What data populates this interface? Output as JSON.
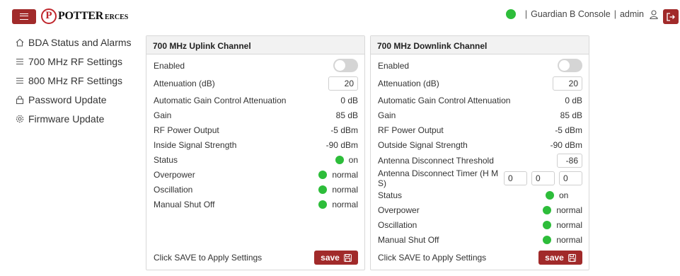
{
  "header": {
    "logo_mark": "P",
    "logo_text": "POTTER",
    "logo_sub": "ERCES",
    "console_name": "Guardian B Console",
    "user": "admin",
    "separator": "|",
    "status_color": "#2dbd3a",
    "accent_color": "#a12a2a"
  },
  "sidebar": {
    "items": [
      {
        "label": "BDA Status and Alarms",
        "icon": "home-icon"
      },
      {
        "label": "700 MHz RF Settings",
        "icon": "menu-lines-icon"
      },
      {
        "label": "800 MHz RF Settings",
        "icon": "menu-lines-icon"
      },
      {
        "label": "Password Update",
        "icon": "lock-icon"
      },
      {
        "label": "Firmware Update",
        "icon": "gear-icon"
      }
    ]
  },
  "uplink": {
    "title": "700 MHz Uplink Channel",
    "enabled_label": "Enabled",
    "enabled": false,
    "attenuation_label": "Attenuation (dB)",
    "attenuation_value": "20",
    "agc_label": "Automatic Gain Control Attenuation",
    "agc_value": "0 dB",
    "gain_label": "Gain",
    "gain_value": "85 dB",
    "rf_power_label": "RF Power Output",
    "rf_power_value": "-5 dBm",
    "signal_label": "Inside Signal Strength",
    "signal_value": "-90 dBm",
    "status_label": "Status",
    "status_value": "on",
    "overpower_label": "Overpower",
    "overpower_value": "normal",
    "oscillation_label": "Oscillation",
    "oscillation_value": "normal",
    "shutoff_label": "Manual Shut Off",
    "shutoff_value": "normal",
    "footer_text": "Click SAVE to Apply Settings",
    "save_label": "save"
  },
  "downlink": {
    "title": "700 MHz Downlink Channel",
    "enabled_label": "Enabled",
    "enabled": false,
    "attenuation_label": "Attenuation (dB)",
    "attenuation_value": "20",
    "agc_label": "Automatic Gain Control Attenuation",
    "agc_value": "0 dB",
    "gain_label": "Gain",
    "gain_value": "85 dB",
    "rf_power_label": "RF Power Output",
    "rf_power_value": "-5 dBm",
    "signal_label": "Outside Signal Strength",
    "signal_value": "-90 dBm",
    "threshold_label": "Antenna Disconnect Threshold",
    "threshold_value": "-86",
    "timer_label": "Antenna Disconnect Timer (H M S)",
    "timer_h": "0",
    "timer_m": "0",
    "timer_s": "0",
    "status_label": "Status",
    "status_value": "on",
    "overpower_label": "Overpower",
    "overpower_value": "normal",
    "oscillation_label": "Oscillation",
    "oscillation_value": "normal",
    "shutoff_label": "Manual Shut Off",
    "shutoff_value": "normal",
    "footer_text": "Click SAVE to Apply Settings",
    "save_label": "save"
  }
}
